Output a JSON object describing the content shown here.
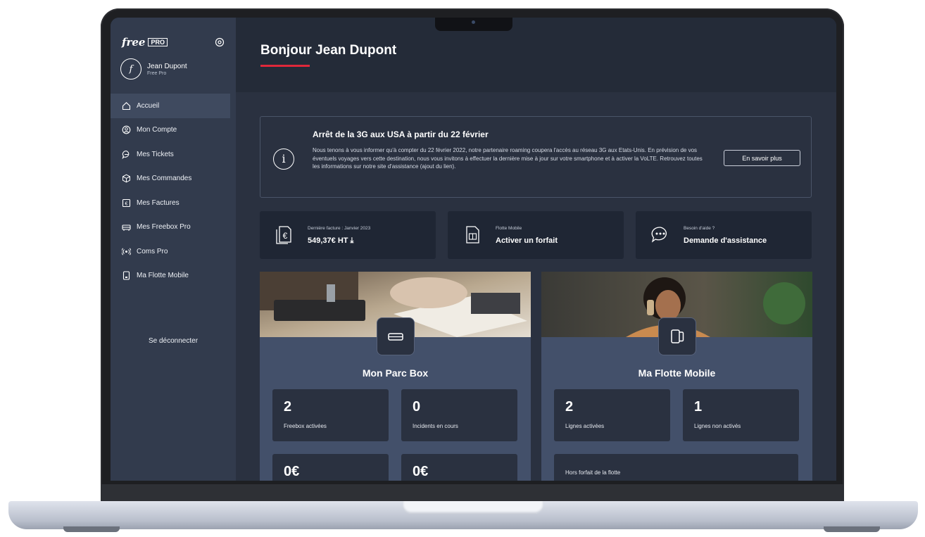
{
  "sidebar": {
    "brand": "free",
    "brand_badge": "PRO",
    "avatar_letter": "f",
    "user_name": "Jean Dupont",
    "user_subtitle": "Free Pro",
    "items": [
      {
        "label": "Accueil",
        "icon": "home-icon"
      },
      {
        "label": "Mon Compte",
        "icon": "user-circle-icon"
      },
      {
        "label": "Mes Tickets",
        "icon": "chat-bubble-icon"
      },
      {
        "label": "Mes Commandes",
        "icon": "package-icon"
      },
      {
        "label": "Mes Factures",
        "icon": "euro-invoice-icon"
      },
      {
        "label": "Mes Freebox Pro",
        "icon": "router-icon"
      },
      {
        "label": "Coms Pro",
        "icon": "broadcast-icon"
      },
      {
        "label": "Ma Flotte Mobile",
        "icon": "mobile-icon"
      }
    ],
    "logout": "Se déconnecter"
  },
  "header": {
    "greeting": "Bonjour Jean Dupont"
  },
  "alert": {
    "title": "Arrêt de la 3G aux USA à partir du 22 février",
    "body": "Nous tenons à vous informer qu'à compter du 22 février 2022, notre partenaire roaming coupera l'accès au réseau 3G aux Etats-Unis. En prévision de vos éventuels voyages vers cette destination, nous vous invitons à effectuer la dernière mise à jour sur votre smartphone et à activer la VoLTE. Retrouvez toutes les informations sur notre site d'assistance (ajout du lien).",
    "button": "En savoir plus"
  },
  "cards": [
    {
      "label": "Dernière facture : Janvier 2023",
      "value": "549,37€ HT ⤓",
      "icon": "invoice-euro-icon"
    },
    {
      "label": "Flotte Mobile",
      "value": "Activer un forfait",
      "icon": "sim-card-icon"
    },
    {
      "label": "Besoin d'aide ?",
      "value": "Demande d'assistance",
      "icon": "chat-dots-icon"
    }
  ],
  "parc_box": {
    "title": "Mon Parc Box",
    "stats": [
      {
        "value": "2",
        "label": "Freebox activées"
      },
      {
        "value": "0",
        "label": "Incidents en cours"
      },
      {
        "value": "0€",
        "label": ""
      },
      {
        "value": "0€",
        "label": ""
      }
    ]
  },
  "flotte": {
    "title": "Ma Flotte Mobile",
    "stats": [
      {
        "value": "2",
        "label": "Lignes activées"
      },
      {
        "value": "1",
        "label": "Lignes non activés"
      }
    ],
    "hors_forfait_label": "Hors forfait de la flotte"
  },
  "colors": {
    "accent": "#e0283a",
    "sidebar": "#323b4d",
    "background": "#2a3140",
    "panel": "#43506a"
  }
}
